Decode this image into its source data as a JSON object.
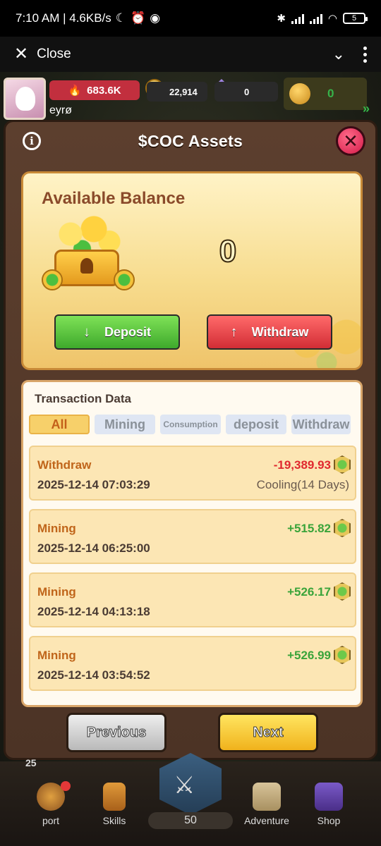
{
  "status_bar": {
    "time_and_speed": "7:10 AM | 4.6KB/s",
    "battery": "5"
  },
  "webview": {
    "close_label": "Close"
  },
  "hud": {
    "power": "683.6K",
    "coins": "22,914",
    "gems": "0",
    "player_name": "eyrø",
    "right_counter": "0"
  },
  "modal": {
    "title": "$COC Assets",
    "balance": {
      "title": "Available Balance",
      "value": "0",
      "deposit_label": "Deposit",
      "withdraw_label": "Withdraw"
    },
    "transactions": {
      "title": "Transaction Data",
      "tabs": [
        {
          "label": "All",
          "active": true
        },
        {
          "label": "Mining"
        },
        {
          "label": "Consumption"
        },
        {
          "label": "deposit"
        },
        {
          "label": "Withdraw"
        }
      ],
      "rows": [
        {
          "type": "Withdraw",
          "date": "2025-12-14 07:03:29",
          "amount": "-19,389.93",
          "status": "Cooling(14 Days)"
        },
        {
          "type": "Mining",
          "date": "2025-12-14 06:25:00",
          "amount": "+515.82",
          "status": ""
        },
        {
          "type": "Mining",
          "date": "2025-12-14 04:13:18",
          "amount": "+526.17",
          "status": ""
        },
        {
          "type": "Mining",
          "date": "2025-12-14 03:54:52",
          "amount": "+526.99",
          "status": ""
        }
      ]
    },
    "prev_label": "Previous",
    "next_label": "Next"
  },
  "bottom_nav": {
    "left_number": "25",
    "items": [
      {
        "label": "port",
        "icon": "port-icon"
      },
      {
        "label": "Skills",
        "icon": "skills-book-icon"
      },
      {
        "label": "Adventure",
        "icon": "adventure-map-icon"
      },
      {
        "label": "Shop",
        "icon": "shop-chest-icon"
      }
    ],
    "level": "50"
  },
  "colors": {
    "deposit": "#4fc135",
    "withdraw": "#e03a44",
    "negative": "#e0282e",
    "positive": "#3aa43a",
    "next": "#f5c92b"
  }
}
